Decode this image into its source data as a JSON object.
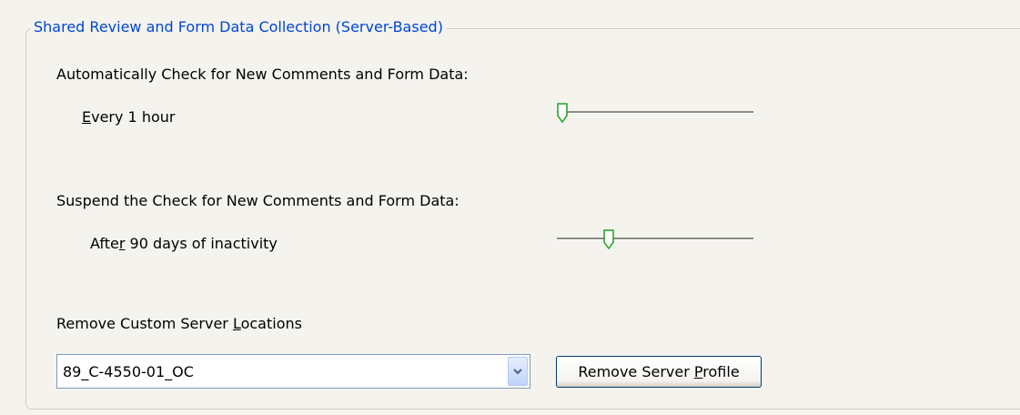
{
  "group": {
    "title": "Shared Review and Form Data Collection (Server-Based)"
  },
  "check_new": {
    "heading": "Automatically Check for New Comments and Form Data:",
    "interval_accel": "E",
    "interval_rest": "very 1 hour",
    "slider_position": 0.0
  },
  "suspend": {
    "heading": "Suspend the Check for New Comments and Form Data:",
    "prefix": "Afte",
    "accel": "r",
    "rest": " 90 days of inactivity",
    "slider_position": 0.25
  },
  "remove_locations": {
    "label_prefix": "Remove Custom Server ",
    "label_accel": "L",
    "label_rest": "ocations",
    "selected_server": "89_C-4550-01_OC",
    "dropdown_icon": "chevron-down-icon"
  },
  "remove_button": {
    "prefix": "Remove Server ",
    "accel": "P",
    "rest": "rofile"
  },
  "colors": {
    "accent_blue": "#0046d5",
    "slider_thumb_green": "#21a121",
    "background": "#f4f3ee"
  }
}
